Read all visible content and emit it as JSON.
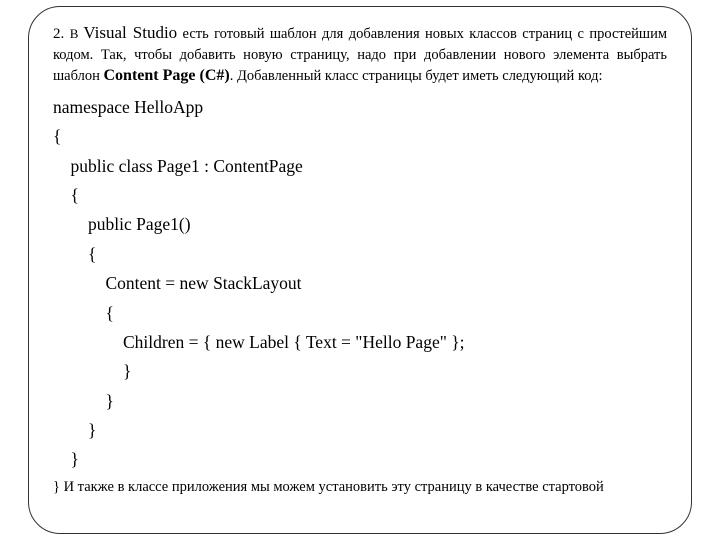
{
  "intro": {
    "part1_num": "2. ",
    "part1_v": "В ",
    "part1_vs": "Visual Studio",
    "part1_rest": " есть готовый шаблон для добавления новых классов страниц с простейшим кодом. Так, чтобы добавить новую страницу, надо при добавлении нового элемента выбрать шаблон ",
    "template": "Content Page (C#)",
    "part2": ". Добавленный класс страницы будет иметь следующий код:"
  },
  "code": {
    "l1": "namespace HelloApp",
    "l2": "{",
    "l3": "    public class Page1 : ContentPage",
    "l4": "    {",
    "l5": "        public Page1()",
    "l6": "        {",
    "l7": "            Content = new StackLayout",
    "l8": "            {",
    "l9": "                Children = { new Label { Text = \"Hello Page\" };",
    "l10": "                }",
    "l11": "            }",
    "l12": "        }",
    "l13": "    }"
  },
  "outro": "} И также в классе приложения мы можем установить эту страницу в качестве стартовой"
}
